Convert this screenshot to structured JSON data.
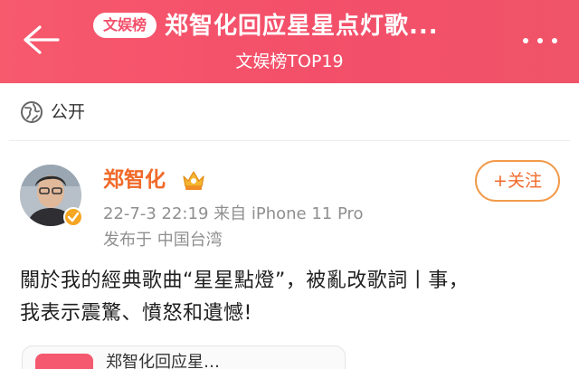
{
  "header": {
    "badge": "文娱榜",
    "title": "郑智化回应星星点灯歌...",
    "subtitle": "文娱榜TOP19",
    "background": "#f34f6a",
    "back_icon": "back-arrow-icon",
    "more_icon": "more-dots-icon"
  },
  "post": {
    "visibility": "公开",
    "visibility_icon": "globe-icon",
    "author": {
      "name": "郑智化",
      "level_icon": "crown-level-icon",
      "verified_icon": "verified-badge-icon"
    },
    "meta": "22-7-3 22:19  来自 iPhone 11 Pro",
    "location": "发布于 中国台湾",
    "follow_label": "+关注",
    "text_lines": [
      "關於我的經典歌曲“星星點燈”，被亂改歌詞丨事，",
      "我表示震驚、憤怒和遺憾!"
    ],
    "name_color": "#f06a2a"
  },
  "bottom_card": {
    "text": "郑智化回应星…"
  }
}
